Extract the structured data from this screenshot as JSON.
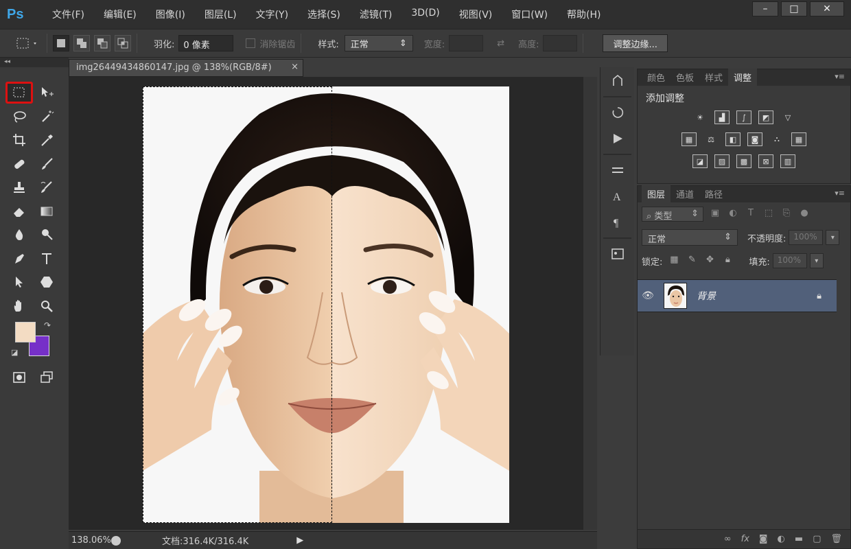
{
  "app": {
    "logo": "Ps"
  },
  "menu": [
    "文件(F)",
    "编辑(E)",
    "图像(I)",
    "图层(L)",
    "文字(Y)",
    "选择(S)",
    "滤镜(T)",
    "3D(D)",
    "视图(V)",
    "窗口(W)",
    "帮助(H)"
  ],
  "window_controls": {
    "minimize": "–",
    "maximize": "□",
    "close": "✕"
  },
  "options": {
    "feather_label": "羽化:",
    "feather_value": "0 像素",
    "antialias_label": "消除锯齿",
    "style_label": "样式:",
    "style_value": "正常",
    "width_label": "宽度:",
    "height_label": "高度:",
    "refine_button": "调整边缘..."
  },
  "toolbox": {
    "colors": {
      "foreground": "#f3dcc3",
      "background": "#7630c8"
    }
  },
  "document": {
    "tab_title": "img26449434860147.jpg @ 138%(RGB/8#)",
    "tab_close": "×",
    "zoom": "138.06%",
    "doc_info": "文档:316.4K/316.4K"
  },
  "adjust_panel": {
    "tabs": [
      "颜色",
      "色板",
      "样式",
      "调整"
    ],
    "active_tab": "调整",
    "title": "添加调整"
  },
  "layers_panel": {
    "tabs": [
      "图层",
      "通道",
      "路径"
    ],
    "active_tab": "图层",
    "filter_value": "类型",
    "blend_mode": "正常",
    "opacity_label": "不透明度:",
    "opacity_value": "100%",
    "lock_label": "锁定:",
    "fill_label": "填充:",
    "fill_value": "100%",
    "layer_name": "背景"
  },
  "accent": {
    "selected_tool_border": "#dd1111",
    "layer_selected": "#51607a",
    "ps_blue": "#3fa7e8"
  }
}
